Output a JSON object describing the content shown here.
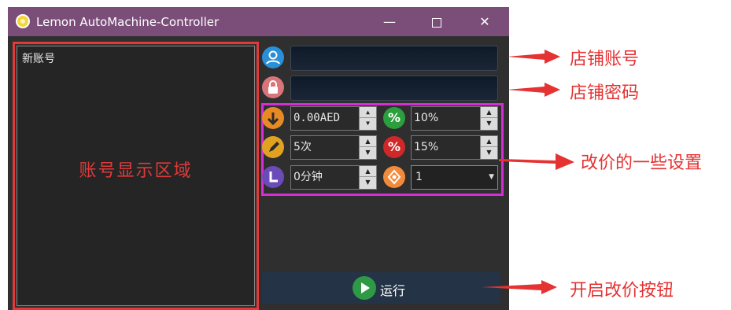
{
  "window": {
    "title": "Lemon AutoMachine-Controller",
    "min_label": "—",
    "close_label": "✕"
  },
  "account_panel": {
    "items": [
      "新账号"
    ],
    "label": "账号显示区域"
  },
  "fields": {
    "account": "",
    "password": ""
  },
  "settings": {
    "price": "0.00AED",
    "percent1": "10%",
    "count": "5次",
    "percent2": "15%",
    "minutes": "0分钟",
    "combo_value": "1"
  },
  "run_button": {
    "label": "运行"
  },
  "annotations": {
    "account": "店铺账号",
    "password": "店铺密码",
    "settings": "改价的一些设置",
    "run": "开启改价按钮"
  },
  "colors": {
    "titlebar": "#7b4e7a",
    "annotation": "#e53232",
    "settings_border": "#d62ed6",
    "panel_border": "#e03a3a"
  }
}
